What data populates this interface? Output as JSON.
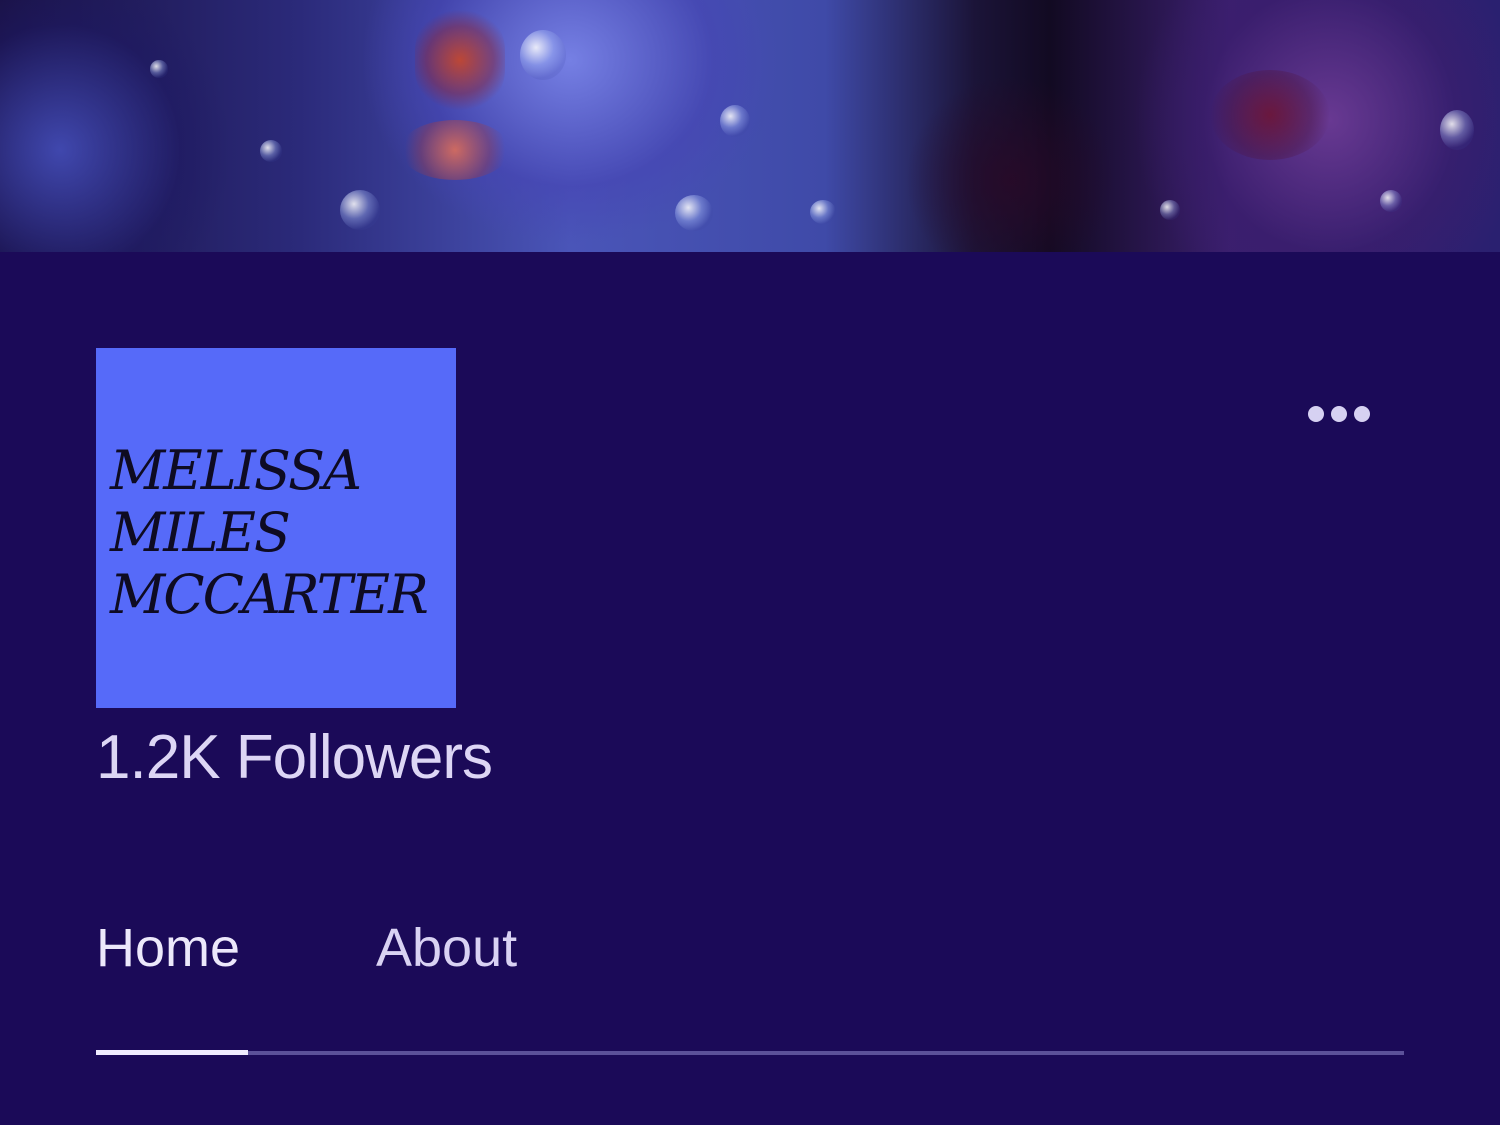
{
  "banner": {
    "image": "water-drops-on-dark-blue-berries"
  },
  "profile": {
    "logo_lines": [
      "MELISSA",
      "MILES",
      "MCCARTER"
    ],
    "logo_background": "#566af9",
    "followers_text": "1.2K Followers"
  },
  "actions": {
    "more_icon": "ellipsis-horizontal-icon"
  },
  "tabs": [
    {
      "label": "Home",
      "selected": true
    },
    {
      "label": "About",
      "selected": false
    }
  ],
  "colors": {
    "page_background": "#1b0a58",
    "text_primary": "#ece8fb",
    "tab_rail": "#5c5199",
    "tab_indicator": "#f0ecff"
  }
}
